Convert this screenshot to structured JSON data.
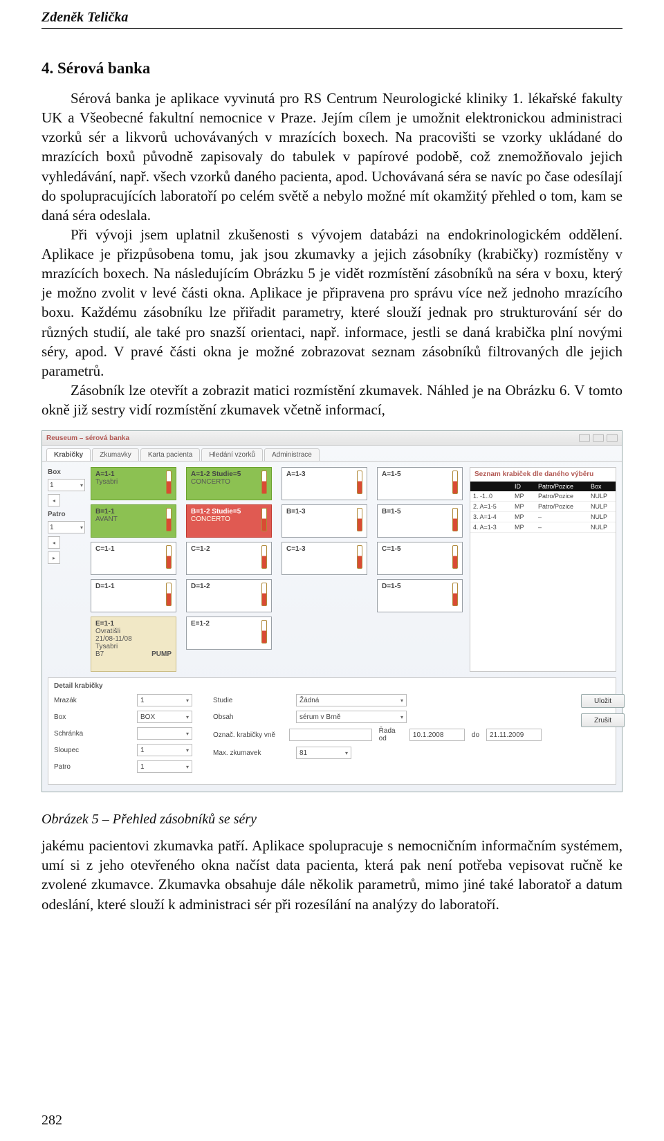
{
  "header": {
    "running_head": "Zdeněk Telička"
  },
  "section": {
    "title": "4. Sérová banka"
  },
  "paragraphs": {
    "p1": "Sérová banka je aplikace vyvinutá pro RS Centrum Neurologické kliniky 1. lékařské fakulty UK a Všeobecné fakultní nemocnice v Praze. Jejím cílem je umožnit elektronickou administraci vzorků sér a likvorů uchovávaných v mrazících boxech. Na pracovišti se vzorky ukládané do mrazících boxů původně zapisovaly do tabulek v papírové podobě, což znemožňovalo jejich vyhledávání, např. všech vzorků daného pacienta, apod. Uchovávaná séra se navíc po čase odesílají do spolupracujících laboratoří po celém světě a nebylo možné mít okamžitý přehled o tom, kam se daná séra odeslala.",
    "p2": "Při vývoji jsem uplatnil zkušenosti s vývojem databázi na endokrinologickém oddělení. Aplikace je přizpůsobena tomu, jak jsou zkumavky a jejich zásobníky (krabičky) rozmístěny v mrazících boxech. Na následujícím Obrázku 5 je vidět rozmístění zásobníků na séra v boxu, který je možno zvolit v levé části okna. Aplikace je připravena pro správu více než jednoho mrazícího boxu. Každému zásobníku lze přiřadit parametry, které slouží jednak pro strukturování sér do různých studií, ale také pro snazší orientaci, např. informace, jestli se daná krabička plní novými séry, apod. V pravé části okna je možné zobrazovat seznam zásobníků filtrovaných dle jejich parametrů.",
    "p3": "Zásobník lze otevřít a zobrazit matici rozmístění zkumavek. Náhled je na Obrázku 6. V tomto okně již sestry vidí rozmístění zkumavek včetně informací,"
  },
  "caption": "Obrázek 5 – Přehled zásobníků se séry",
  "paragraphs2": {
    "p4": "jakému pacientovi zkumavka patří. Aplikace spolupracuje s nemocničním informačním systémem, umí si z jeho otevřeného okna načíst data pacienta, která pak není potřeba vepisovat ručně ke zvolené zkumavce. Zkumavka obsahuje dále několik parametrů, mimo jiné také laboratoř a datum odeslání, které slouží k administraci sér při rozesílání na analýzy do laboratoří."
  },
  "page_number": "282",
  "app": {
    "title": "Reuseum – sérová banka",
    "tabs": [
      "Krabičky",
      "Zkumavky",
      "Karta pacienta",
      "Hledání vzorků",
      "Administrace"
    ],
    "active_tab_index": 0,
    "left": {
      "label_box": "Box",
      "box_value": "1",
      "label_patro": "Patro",
      "patro_value": "1"
    },
    "grid": {
      "cells": {
        "r1c1": {
          "title": "A=1-1",
          "sub": "Tysabri"
        },
        "r1c2": {
          "title": "A=1-2   Studie=5",
          "sub": "CONCERTO"
        },
        "r1c3": {
          "title": "A=1-3",
          "sub": ""
        },
        "r1c4": {
          "title": "A=1-5",
          "sub": ""
        },
        "r2c1": {
          "title": "B=1-1",
          "sub": "AVANT"
        },
        "r2c2": {
          "title": "B=1-2   Studie=5",
          "sub": "CONCERTO"
        },
        "r2c3": {
          "title": "B=1-3",
          "sub": ""
        },
        "r2c4": {
          "title": "B=1-5",
          "sub": ""
        },
        "r3c1": {
          "title": "C=1-1",
          "sub": ""
        },
        "r3c2": {
          "title": "C=1-2",
          "sub": ""
        },
        "r3c3": {
          "title": "C=1-3",
          "sub": ""
        },
        "r3c4": {
          "title": "C=1-5",
          "sub": ""
        },
        "r4c1": {
          "title": "D=1-1",
          "sub": ""
        },
        "r4c2": {
          "title": "D=1-2",
          "sub": ""
        },
        "r4c4": {
          "title": "D=1-5",
          "sub": ""
        },
        "r5c1": {
          "title": "E=1-1",
          "sub1": "Ovratišli",
          "sub2": "21/08-11/08",
          "sub3": "Tysabri",
          "sub4": "B7",
          "right": "PUMP"
        },
        "r5c2": {
          "title": "E=1-2",
          "sub": ""
        }
      }
    },
    "right": {
      "title": "Seznam krabiček dle daného výběru",
      "headers": [
        "",
        "ID",
        "Patro/Pozice",
        "Box"
      ],
      "rows": [
        {
          "c1": "1. -1..0",
          "c2": "MP",
          "c3": "Patro/Pozice",
          "c4": "NULP"
        },
        {
          "c1": "2. A=1-5",
          "c2": "MP",
          "c3": "Patro/Pozice",
          "c4": "NULP"
        },
        {
          "c1": "3. A=1-4",
          "c2": "MP",
          "c3": "–",
          "c4": "NULP"
        },
        {
          "c1": "4. A=1-3",
          "c2": "MP",
          "c3": "–",
          "c4": "NULP"
        }
      ]
    },
    "detail": {
      "panel_title": "Detail krabičky",
      "rows": {
        "mrazak_label": "Mrazák",
        "mrazak_val": "1",
        "studie_label": "Studie",
        "studie_val": "Žádná",
        "box_label": "Box",
        "box_val": "BOX",
        "schranka_label": "Schránka",
        "schranka_val": "",
        "obsah_label": "Obsah",
        "obsah_val": "sérum v Brně",
        "sloupec_label": "Sloupec",
        "sloupec_val": "1",
        "ozn_krab_label": "Označ. krabičky vně",
        "ozn_krab_val": "",
        "rada_label": "Řada od",
        "rada_val": "10.1.2008",
        "rada_do_label": "do",
        "rada_do_val": "21.11.2009",
        "patro_label": "Patro",
        "patro_val": "1",
        "max_label": "Max. zkumavek",
        "max_val": "81"
      },
      "buttons": {
        "submit": "Uložit",
        "cancel": "Zrušit"
      }
    }
  }
}
